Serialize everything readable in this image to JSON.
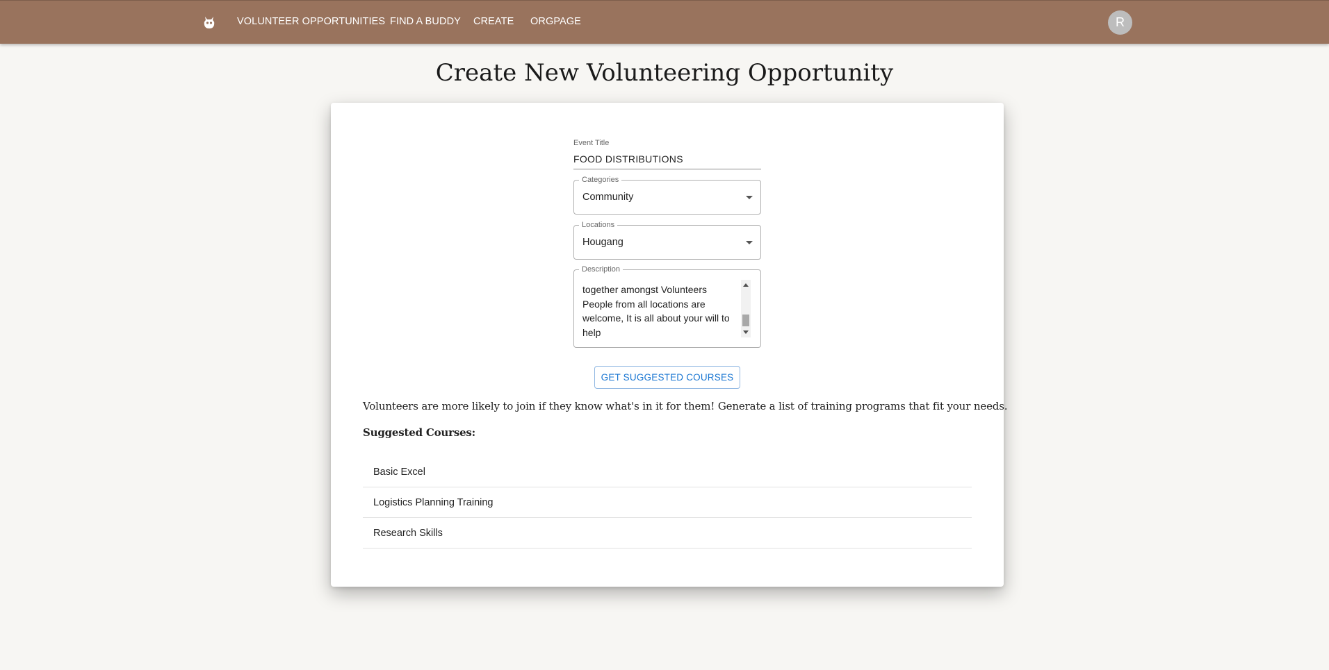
{
  "nav": {
    "logo_icon": "robot-icon",
    "links": [
      "VOLUNTEER OPPORTUNITIES",
      "FIND A BUDDY",
      "CREATE",
      "ORGPAGE"
    ],
    "avatar_initial": "R",
    "bar_color": "#99735d"
  },
  "page": {
    "title": "Create New Volunteering Opportunity"
  },
  "form": {
    "event_title_label": "Event Title",
    "event_title_value": "FOOD DISTRIBUTIONS",
    "categories_label": "Categories",
    "categories_value": "Community",
    "locations_label": "Locations",
    "locations_value": "Hougang",
    "description_label": "Description",
    "description_lines": [
      "·",
      "together amongst Volunteers",
      "People from all locations are",
      "welcome, It is all about your will to",
      "help"
    ],
    "suggest_button": "GET SUGGESTED COURSES"
  },
  "suggestions": {
    "blurb": "Volunteers are more likely to join if they know what's in it for them! Generate a list of training programs that fit your needs.",
    "heading": "Suggested Courses:",
    "courses": [
      "Basic Excel",
      "Logistics Planning Training",
      "Research Skills"
    ]
  },
  "colors": {
    "accent": "#1976d2",
    "background": "#f7f6f3"
  }
}
